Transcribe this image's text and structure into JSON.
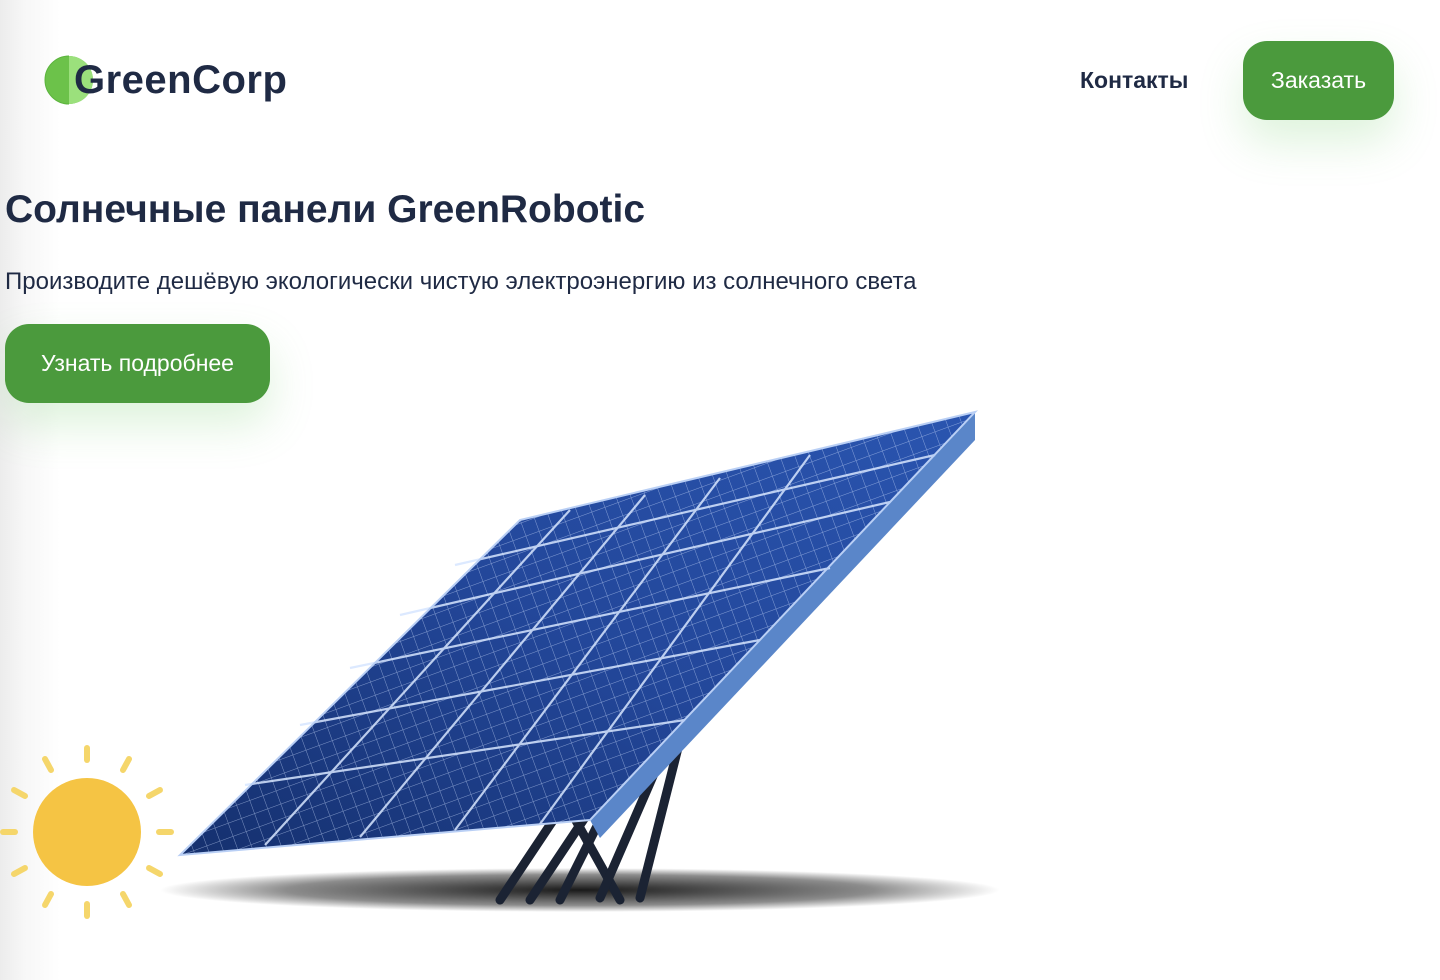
{
  "brand": {
    "logo_text": "GreenCorp"
  },
  "nav": {
    "contacts_label": "Контакты",
    "order_button": "Заказать"
  },
  "hero": {
    "title": "Солнечные панели GreenRobotic",
    "subtitle": "Производите дешёвую экологически чистую электроэнергию из солнечного света",
    "cta_button": "Узнать подробнее"
  },
  "icons": {
    "logo": "leaf-circle-icon",
    "sun": "sun-icon",
    "panel": "solar-panel-image"
  },
  "colors": {
    "accent": "#4b9a3d",
    "text": "#1f2a44",
    "logo_green": "#6cc24a",
    "sun": "#f5c444",
    "panel": "#1e3f8a"
  }
}
